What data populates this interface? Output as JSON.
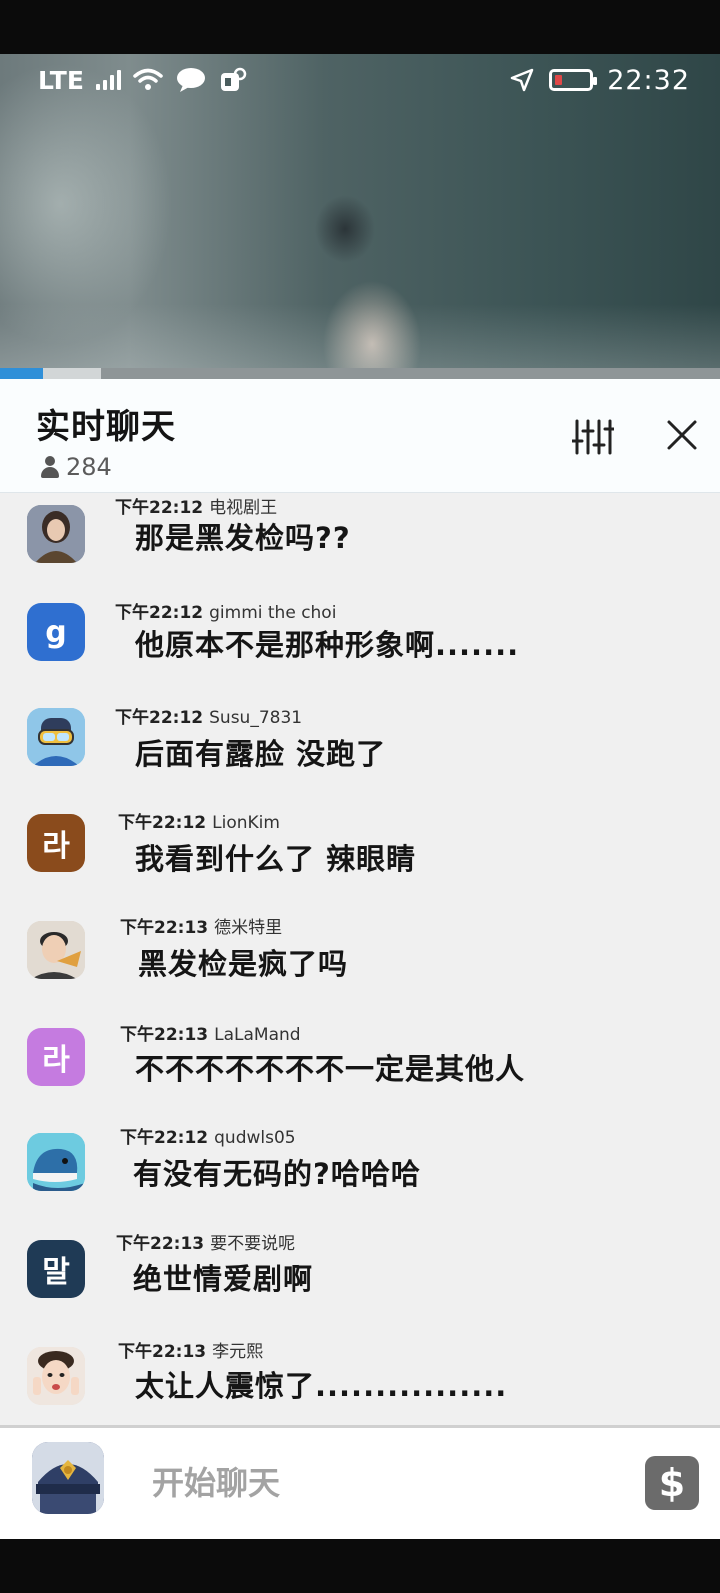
{
  "status_bar": {
    "network": "LTE",
    "time": "22:32",
    "battery_level": 0.1
  },
  "video": {
    "progress_played": 0.06,
    "progress_buffered": 0.14
  },
  "chat": {
    "title": "实时聊天",
    "viewer_count": "284"
  },
  "messages": [
    {
      "time": "下午22:12",
      "user": "电视剧王",
      "text": "那是黑发检吗??",
      "avatar": {
        "type": "image",
        "icon": "woman-portrait-icon",
        "bg": "#7f8aa0"
      }
    },
    {
      "time": "下午22:12",
      "user": "gimmi the choi",
      "text": "他原本不是那种形象啊.......",
      "avatar": {
        "type": "letter",
        "letter": "g",
        "bg": "#2f6fd0"
      }
    },
    {
      "time": "下午22:12",
      "user": "Susu_7831",
      "text": "后面有露脸 没跑了",
      "avatar": {
        "type": "image",
        "icon": "diver-cartoon-icon",
        "bg": "#8fc6e8"
      }
    },
    {
      "time": "下午22:12",
      "user": "LionKim",
      "text": "我看到什么了 辣眼睛",
      "avatar": {
        "type": "letter",
        "letter": "라",
        "bg": "#8a4b1c"
      }
    },
    {
      "time": "下午22:13",
      "user": "德米特里",
      "text": "黑发检是疯了吗",
      "avatar": {
        "type": "image",
        "icon": "man-eating-icon",
        "bg": "#d9d0c6"
      }
    },
    {
      "time": "下午22:13",
      "user": "LaLaMand",
      "text": "不不不不不不不一定是其他人",
      "avatar": {
        "type": "letter",
        "letter": "라",
        "bg": "#c57be0"
      }
    },
    {
      "time": "下午22:12",
      "user": "qudwls05",
      "text": "有没有无码的?哈哈哈",
      "avatar": {
        "type": "image",
        "icon": "whale-icon",
        "bg": "#66c6de"
      }
    },
    {
      "time": "下午22:13",
      "user": "要不要说呢",
      "text": "绝世情爱剧啊",
      "avatar": {
        "type": "letter",
        "letter": "말",
        "bg": "#1f3a55"
      }
    },
    {
      "time": "下午22:13",
      "user": "李元熙",
      "text": "太让人震惊了................",
      "avatar": {
        "type": "image",
        "icon": "woman-face-icon",
        "bg": "#e9ddd4"
      }
    }
  ],
  "input": {
    "placeholder": "开始聊天",
    "donate_symbol": "$"
  }
}
